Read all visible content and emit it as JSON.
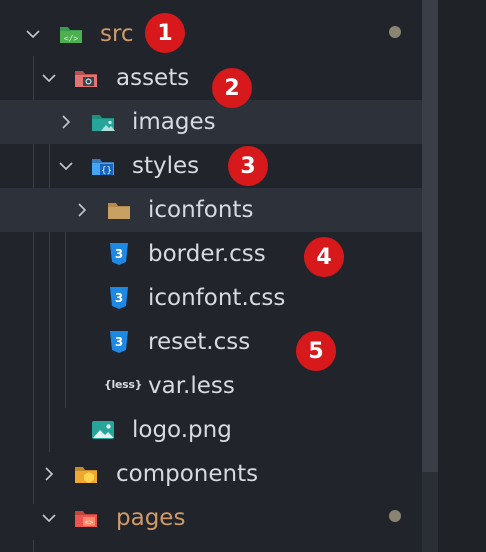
{
  "explorer": {
    "items": [
      {
        "label": "src",
        "badge": "1"
      },
      {
        "label": "assets",
        "badge": "2"
      },
      {
        "label": "images"
      },
      {
        "label": "styles",
        "badge": "3"
      },
      {
        "label": "iconfonts"
      },
      {
        "label": "border.css",
        "badge": "4"
      },
      {
        "label": "iconfont.css"
      },
      {
        "label": "reset.css",
        "badge": "5"
      },
      {
        "label": "var.less",
        "icon_text": "{less}"
      },
      {
        "label": "logo.png"
      },
      {
        "label": "components"
      },
      {
        "label": "pages"
      }
    ]
  },
  "icons": {
    "src": "folder-src-icon",
    "assets": "folder-assets-icon",
    "images": "folder-images-icon",
    "styles": "folder-styles-icon",
    "iconfonts": "folder-icon",
    "css": "css3-icon",
    "less": "less-icon",
    "png": "image-file-icon",
    "components": "folder-components-icon",
    "pages": "folder-pages-icon"
  },
  "colors": {
    "background": "#21252b",
    "selected_row": "#2c313a",
    "text": "#d7dae0",
    "modified_text": "#d19a66",
    "badge": "#d7191c"
  }
}
